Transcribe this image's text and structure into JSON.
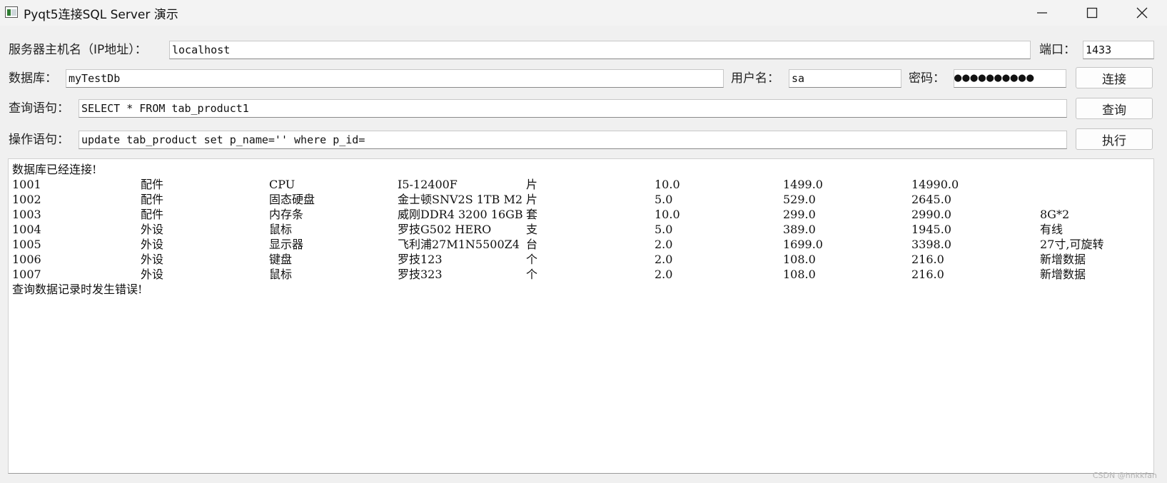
{
  "window": {
    "title": "Pyqt5连接SQL Server 演示",
    "icon": "app-window-icon",
    "controls": [
      "minimize-icon",
      "maximize-icon",
      "close-icon"
    ]
  },
  "form": {
    "host_label": "服务器主机名（IP地址）：",
    "host_value": "localhost",
    "port_label": "端口：",
    "port_value": "1433",
    "db_label": "数据库：",
    "db_value": "myTestDb",
    "user_label": "用户名：",
    "user_value": "sa",
    "pwd_label": "密码：",
    "pwd_value": "●●●●●●●●●●",
    "connect_button": "连接",
    "query_label": "查询语句：",
    "query_value": "SELECT * FROM tab_product1",
    "query_button": "查询",
    "exec_label": "操作语句：",
    "exec_value": "update tab_product set p_name='' where p_id=",
    "exec_button": "执行"
  },
  "output": {
    "connected_msg": "数据库已经连接!",
    "rows": [
      [
        "1001",
        "配件",
        "CPU",
        "I5-12400F",
        "片",
        "10.0",
        "1499.0",
        "14990.0",
        ""
      ],
      [
        "1002",
        "配件",
        "固态硬盘",
        "金士顿SNV2S 1TB M2",
        "片",
        "5.0",
        "529.0",
        "2645.0",
        ""
      ],
      [
        "1003",
        "配件",
        "内存条",
        "威刚DDR4 3200 16GB",
        "套",
        "10.0",
        "299.0",
        "2990.0",
        "8G*2"
      ],
      [
        "1004",
        "外设",
        "鼠标",
        "罗技G502 HERO",
        "支",
        "5.0",
        "389.0",
        "1945.0",
        "有线"
      ],
      [
        "1005",
        "外设",
        "显示器",
        "飞利浦27M1N5500Z4",
        "台",
        "2.0",
        "1699.0",
        "3398.0",
        "27寸,可旋转"
      ],
      [
        "1006",
        "外设",
        "键盘",
        "罗技123",
        "个",
        "2.0",
        "108.0",
        "216.0",
        "新增数据"
      ],
      [
        "1007",
        "外设",
        "鼠标",
        "罗技323",
        "个",
        "2.0",
        "108.0",
        "216.0",
        "新增数据"
      ]
    ],
    "error_msg": "查询数据记录时发生错误!"
  },
  "watermark": "CSDN @hnkkfan"
}
